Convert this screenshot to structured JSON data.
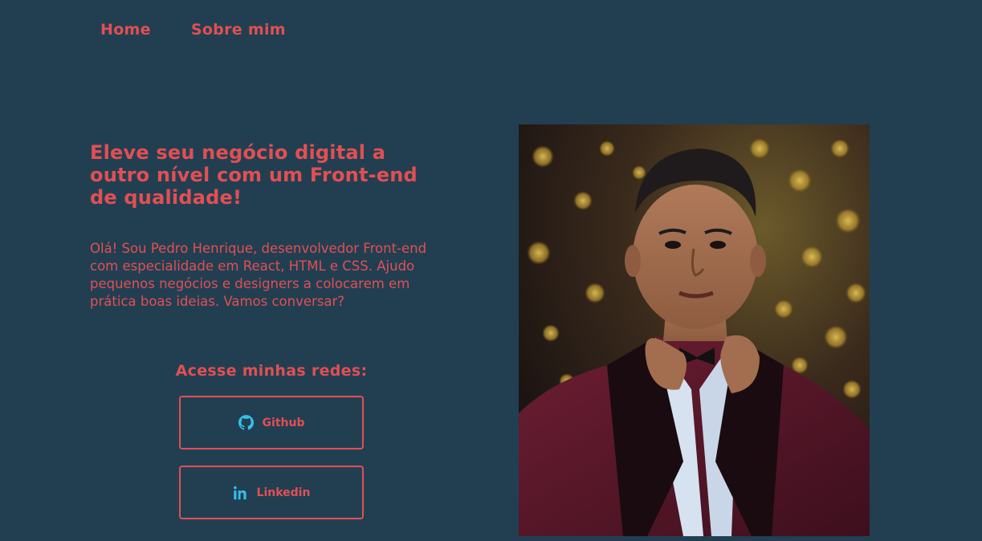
{
  "nav": {
    "home_label": "Home",
    "about_label": "Sobre mim"
  },
  "hero": {
    "title": "Eleve seu negócio digital a outro nível com um Front-end de qualidade!",
    "intro": "Olá! Sou Pedro Henrique, desenvolvedor Front-end com especialidade em React, HTML e CSS. Ajudo pequenos negócios e designers a colocarem em prática boas ideias. Vamos conversar?"
  },
  "social": {
    "heading": "Acesse minhas redes:",
    "buttons": [
      {
        "label": "Github",
        "icon": "github-icon"
      },
      {
        "label": "Linkedin",
        "icon": "linkedin-icon"
      }
    ]
  },
  "colors": {
    "background": "#223f52",
    "accent": "#e24f53",
    "icon": "#35c0e8"
  }
}
